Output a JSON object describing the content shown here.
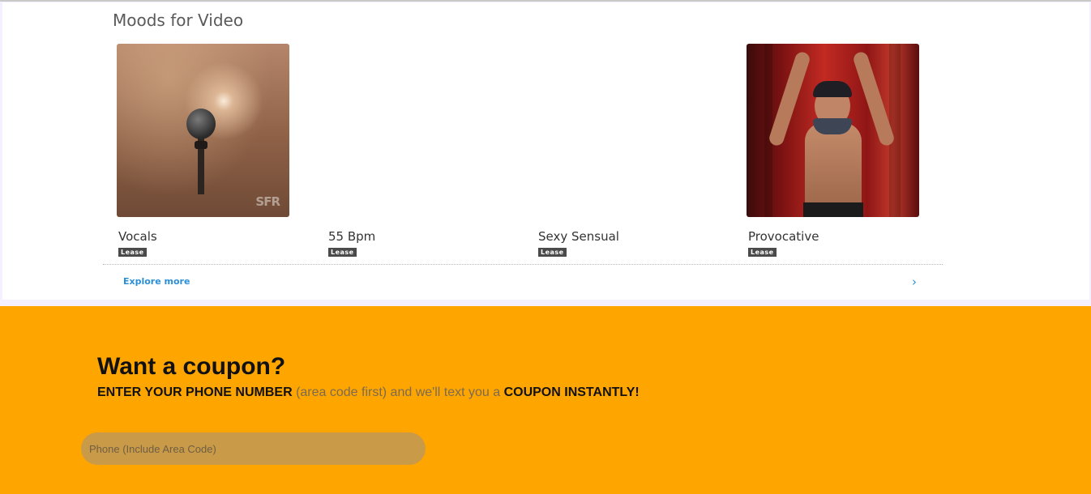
{
  "moods": {
    "title": "Moods for Video",
    "items": [
      {
        "name": "Vocals",
        "badge": "Lease",
        "thumb_watermark": "SFR"
      },
      {
        "name": "55 Bpm",
        "badge": "Lease"
      },
      {
        "name": "Sexy Sensual",
        "badge": "Lease"
      },
      {
        "name": "Provocative",
        "badge": "Lease"
      }
    ],
    "explore_label": "Explore more",
    "explore_icon": "chevron-right-icon"
  },
  "coupon": {
    "title": "Want a coupon?",
    "line_part1": "ENTER YOUR PHONE NUMBER",
    "line_part2": " (area code first) and we'll text you a ",
    "line_part3": "COUPON INSTANTLY!",
    "phone_placeholder": "Phone (Include Area Code)",
    "phone_value": ""
  },
  "colors": {
    "coupon_background": "#ffa500",
    "link": "#2b8fd6",
    "badge": "#4a4a4a",
    "input_fill": "#c99a48"
  }
}
